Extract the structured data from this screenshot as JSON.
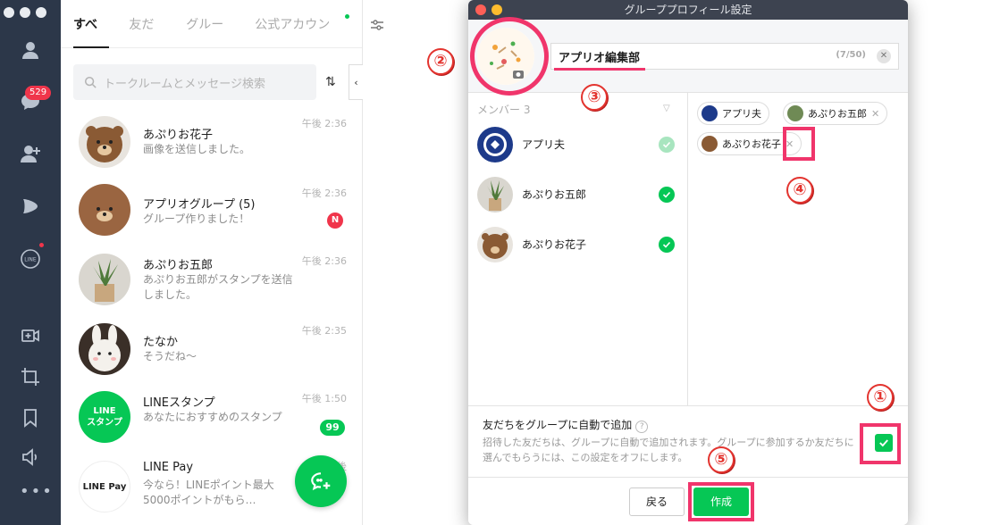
{
  "sidebar": {
    "badge_count": "529"
  },
  "tabs": [
    {
      "label": "すべて"
    },
    {
      "label": "友だち"
    },
    {
      "label": "グループ"
    },
    {
      "label": "公式アカウント"
    }
  ],
  "search": {
    "placeholder": "トークルームとメッセージ検索"
  },
  "chats": [
    {
      "name": "あぷりお花子",
      "message": "画像を送信しました。",
      "time": "午後 2:36"
    },
    {
      "name": "アプリオグループ (5)",
      "message": "グループ作りました！",
      "time": "午後 2:36",
      "badge": "N"
    },
    {
      "name": "あぷりお五郎",
      "message": "あぷりお五郎がスタンプを送信しました。",
      "time": "午後 2:36"
    },
    {
      "name": "たなか",
      "message": "そうだね〜",
      "time": "午後 2:35"
    },
    {
      "name": "LINEスタンプ",
      "message": "あなたにおすすめのスタンプ",
      "time": "午後 1:50",
      "badge": "99",
      "avatar_text": "LINE\nスタンプ"
    },
    {
      "name": "LINE Pay",
      "message": "今なら！LINEポイント最大5000ポイントがもら…",
      "time": "午後",
      "avatar_text": "LINE Pay"
    }
  ],
  "dialog": {
    "title": "グループプロフィール設定",
    "group_name": "アプリオ編集部",
    "name_counter": "(7/50)",
    "members_header": "メンバー 3",
    "members": [
      {
        "name": "アプリ夫"
      },
      {
        "name": "あぷりお五郎"
      },
      {
        "name": "あぷりお花子"
      }
    ],
    "selected": [
      {
        "name": "アプリ夫"
      },
      {
        "name": "あぷりお五郎"
      },
      {
        "name": "あぷりお花子"
      }
    ],
    "auto_add_title": "友だちをグループに自動で追加",
    "auto_add_desc": "招待した友だちは、グループに自動で追加されます。グループに参加するか友だちに選んでもらうには、この設定をオフにします。",
    "auto_add_checked": true,
    "back_label": "戻る",
    "create_label": "作成"
  },
  "annotations": [
    "①",
    "②",
    "③",
    "④",
    "⑤"
  ],
  "colors": {
    "line_green": "#06c755",
    "rail": "#2c3749",
    "annotation": "#f0356b"
  }
}
